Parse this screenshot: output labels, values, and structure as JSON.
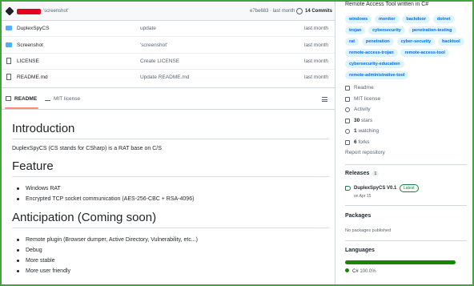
{
  "commit": {
    "message": "'screenshot'",
    "hash_time": "e7be683 · last month",
    "count": "14 Commits"
  },
  "files": [
    {
      "name": "DuplexSpyCS",
      "type": "folder",
      "message": "update",
      "date": "last month"
    },
    {
      "name": "Screenshot",
      "type": "folder",
      "message": "'screenshot'",
      "date": "last month"
    },
    {
      "name": "LICENSE",
      "type": "file",
      "message": "Create LICENSE",
      "date": "last month"
    },
    {
      "name": "README.md",
      "type": "file",
      "message": "Update README.md",
      "date": "last month"
    }
  ],
  "readme_tabs": {
    "readme": "README",
    "license": "MIT license"
  },
  "readme": {
    "h_intro": "Introduction",
    "intro_text": "DuplexSpyCS (CS stands for CSharp) is a RAT base on C/S",
    "h_feature": "Feature",
    "features": [
      "Windows RAT",
      "Encrypted TCP socket communication (AES-256-CBC + RSA-4096)"
    ],
    "h_anticipation": "Anticipation (Coming soon)",
    "anticipation": [
      "Remote plugin (Browser dumper, Active Directory, Vulnerability, etc...)",
      "Debug",
      "More stable",
      "More user friendly"
    ]
  },
  "about": {
    "description": "Remote Access Tool written in C#",
    "topics": [
      "windows",
      "monitor",
      "backdoor",
      "dotnet",
      "trojan",
      "cybersecurity",
      "penetration-testing",
      "rat",
      "penetration",
      "cyber-security",
      "hacktool",
      "remote-access-trojan",
      "remote-access-tool",
      "cybersecurity-education",
      "remote-administrative-tool"
    ],
    "readme": "Readme",
    "license": "MIT license",
    "activity": "Activity",
    "stars_num": "30",
    "stars_label": "stars",
    "watching_num": "1",
    "watching_label": "watching",
    "forks_num": "6",
    "forks_label": "forks",
    "report": "Report repository"
  },
  "releases": {
    "title": "Releases",
    "count": "1",
    "name": "DuplexSpyCS V0.1",
    "badge": "Latest",
    "date": "on Apr 15"
  },
  "packages": {
    "title": "Packages",
    "empty": "No packages published"
  },
  "languages": {
    "title": "Languages",
    "name": "C#",
    "percent": "100.0%",
    "color": "#178600"
  }
}
